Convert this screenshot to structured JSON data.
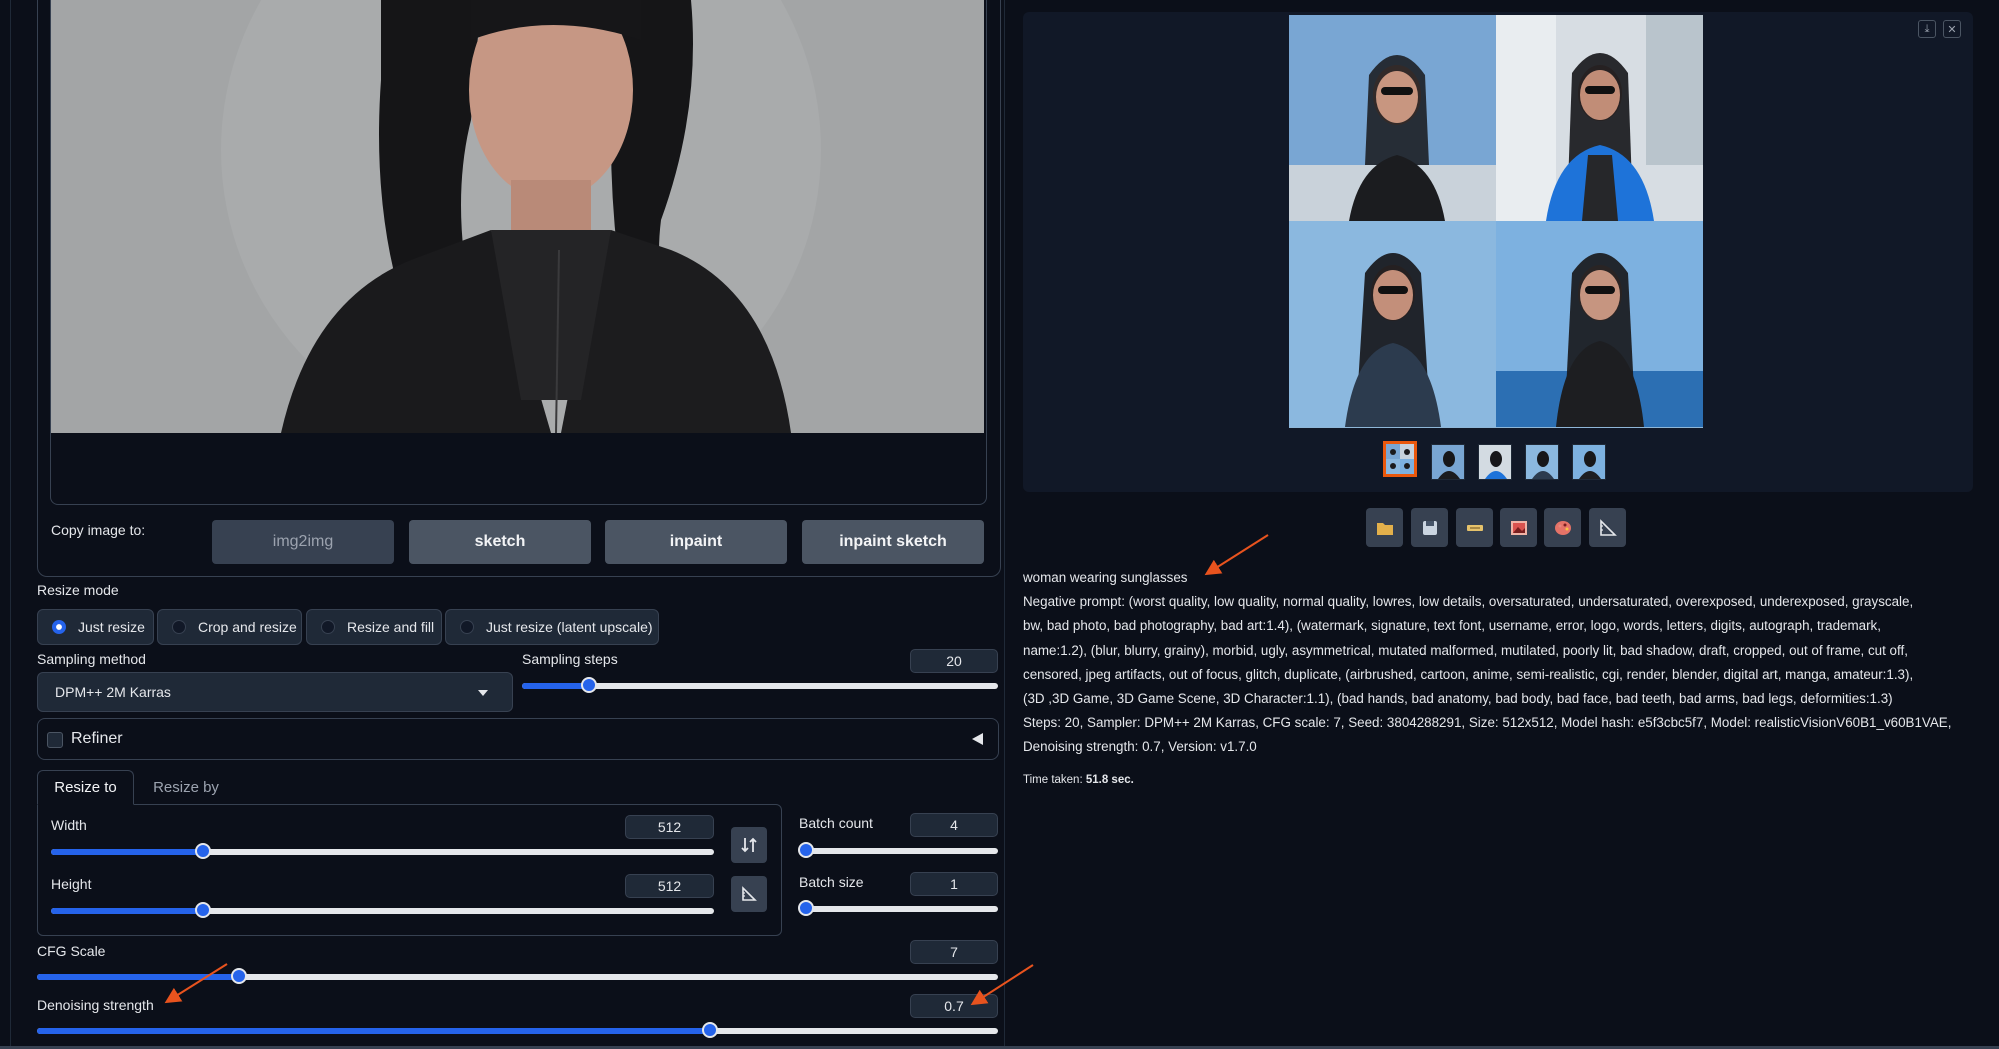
{
  "copy_image": {
    "label": "Copy image to:",
    "buttons": [
      "img2img",
      "sketch",
      "inpaint",
      "inpaint sketch"
    ]
  },
  "resize_mode": {
    "label": "Resize mode",
    "options": [
      "Just resize",
      "Crop and resize",
      "Resize and fill",
      "Just resize (latent upscale)"
    ],
    "selected": "Just resize"
  },
  "sampling": {
    "method_label": "Sampling method",
    "method_value": "DPM++ 2M Karras",
    "steps_label": "Sampling steps",
    "steps_value": "20",
    "steps_fraction": 0.14
  },
  "refiner": {
    "label": "Refiner",
    "collapse_icon": "triangle-left-icon"
  },
  "tabs": [
    "Resize to",
    "Resize by"
  ],
  "width": {
    "label": "Width",
    "value": "512",
    "fraction": 0.23
  },
  "height": {
    "label": "Height",
    "value": "512",
    "fraction": 0.23
  },
  "batch_count": {
    "label": "Batch count",
    "value": "4",
    "fraction": 0.0
  },
  "batch_size": {
    "label": "Batch size",
    "value": "1",
    "fraction": 0.0
  },
  "cfg_scale": {
    "label": "CFG Scale",
    "value": "7",
    "fraction": 0.21
  },
  "denoising": {
    "label": "Denoising strength",
    "value": "0.7",
    "fraction": 0.7
  },
  "gallery": {
    "toolbar_icons": [
      "folder-icon",
      "save-icon",
      "zip-icon",
      "image-send-icon",
      "palette-icon",
      "ruler-icon"
    ],
    "corner_icons": [
      "download-icon",
      "close-icon"
    ]
  },
  "info": {
    "prompt": "woman wearing sunglasses",
    "lines": [
      "Negative prompt: (worst quality, low quality, normal quality, lowres, low details, oversaturated, undersaturated, overexposed, underexposed, grayscale,",
      "bw, bad photo, bad photography, bad art:1.4), (watermark, signature, text font, username, error, logo, words, letters, digits, autograph, trademark,",
      "name:1.2), (blur, blurry, grainy), morbid, ugly, asymmetrical, mutated malformed, mutilated, poorly lit, bad shadow, draft, cropped, out of frame, cut off,",
      "censored, jpeg artifacts, out of focus, glitch, duplicate, (airbrushed, cartoon, anime, semi-realistic, cgi, render, blender, digital art, manga, amateur:1.3),",
      "(3D ,3D Game, 3D Game Scene, 3D Character:1.1), (bad hands, bad anatomy, bad body, bad face, bad teeth, bad arms, bad legs, deformities:1.3)",
      "Steps: 20, Sampler: DPM++ 2M Karras, CFG scale: 7, Seed: 3804288291, Size: 512x512, Model hash: e5f3cbc5f7, Model: realisticVisionV60B1_v60B1VAE,",
      "Denoising strength: 0.7, Version: v1.7.0"
    ],
    "time_label": "Time taken:",
    "time_value": "51.8 sec."
  },
  "colors": {
    "accent": "#2563eb",
    "background": "#0b0f19",
    "annotation_arrow": "#e8531e",
    "selected_thumb": "#ea580c"
  }
}
